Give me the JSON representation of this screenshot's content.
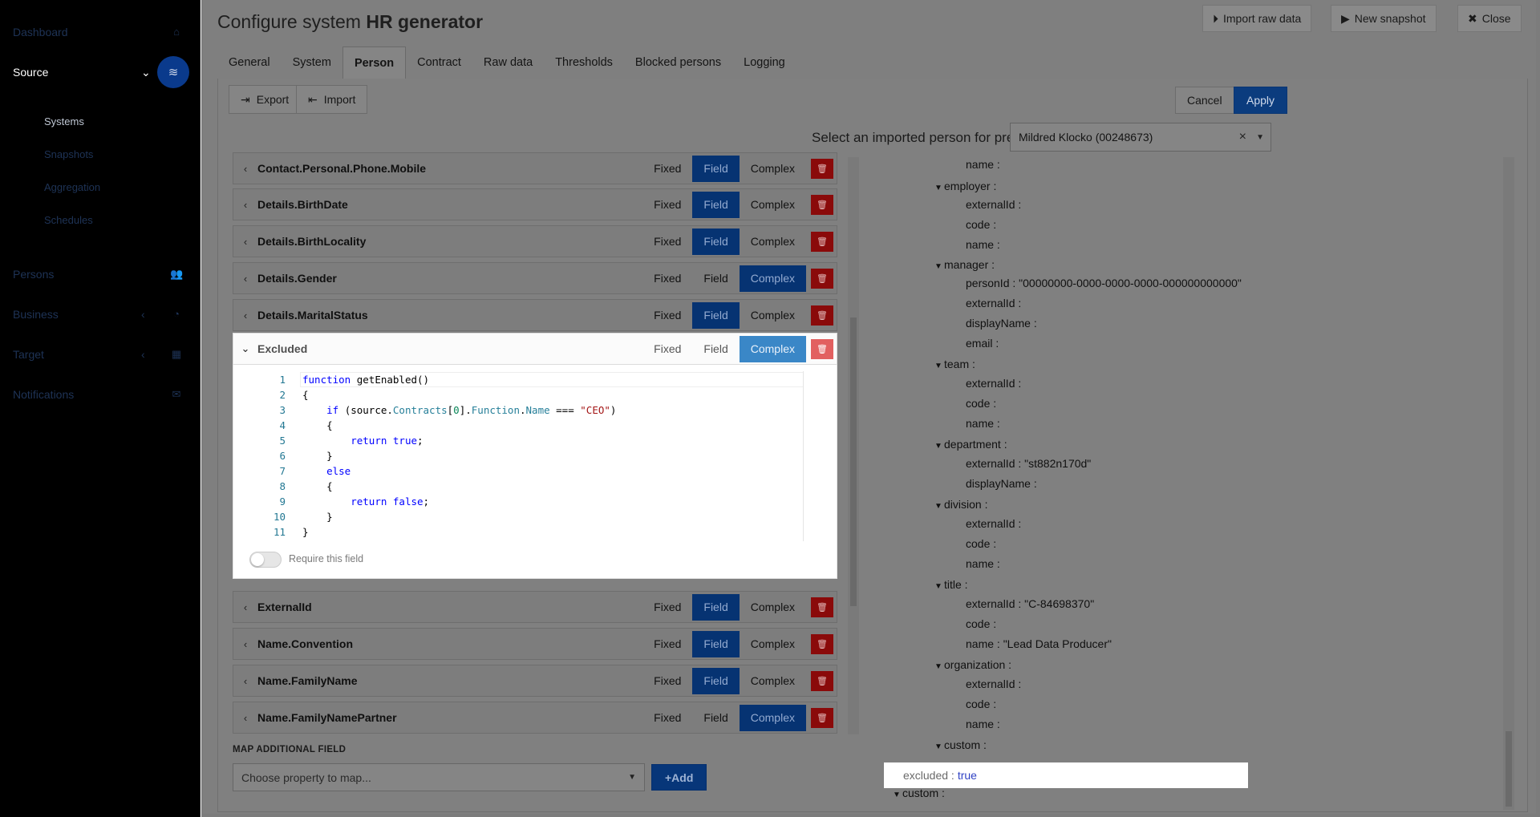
{
  "sidebar": {
    "items": [
      {
        "label": "Dashboard",
        "icon": "home-icon"
      },
      {
        "label": "Source",
        "icon": "layers-icon"
      },
      {
        "label": "Persons",
        "icon": "users-icon"
      },
      {
        "label": "Business",
        "icon": "chart-icon"
      },
      {
        "label": "Target",
        "icon": "grid-icon"
      },
      {
        "label": "Notifications",
        "icon": "envelope-icon"
      }
    ],
    "sub_items": [
      "Systems",
      "Snapshots",
      "Aggregation",
      "Schedules"
    ]
  },
  "modal": {
    "title_prefix": "Configure system",
    "title_system": "HR generator",
    "buttons": {
      "import_raw": "Import raw data",
      "new_snapshot": "New snapshot",
      "close": "Close"
    },
    "tabs": [
      "General",
      "System",
      "Person",
      "Contract",
      "Raw data",
      "Thresholds",
      "Blocked persons",
      "Logging"
    ],
    "active_tab": "Person",
    "toolbar": {
      "export": "Export",
      "import": "Import",
      "cancel": "Cancel",
      "apply": "Apply"
    },
    "preview": {
      "label": "Select an imported person for preview",
      "selected": "Mildred Klocko (00248673)"
    }
  },
  "mapping": {
    "segments": {
      "fixed": "Fixed",
      "field": "Field",
      "complex": "Complex"
    },
    "rows": [
      {
        "name": "Contact.Personal.Phone.Mobile",
        "mode": "field"
      },
      {
        "name": "Details.BirthDate",
        "mode": "field"
      },
      {
        "name": "Details.BirthLocality",
        "mode": "field"
      },
      {
        "name": "Details.Gender",
        "mode": "complex"
      },
      {
        "name": "Details.MaritalStatus",
        "mode": "field"
      },
      {
        "name": "Excluded",
        "mode": "complex",
        "expanded": true
      },
      {
        "name": "ExternalId",
        "mode": "field"
      },
      {
        "name": "Name.Convention",
        "mode": "field"
      },
      {
        "name": "Name.FamilyName",
        "mode": "field"
      },
      {
        "name": "Name.FamilyNamePartner",
        "mode": "complex"
      }
    ],
    "code_lines": [
      "1",
      "2",
      "3",
      "4",
      "5",
      "6",
      "7",
      "8",
      "9",
      "10",
      "11"
    ],
    "require_label": "Require this field",
    "additional_label": "MAP ADDITIONAL FIELD",
    "additional_placeholder": "Choose property to map...",
    "add_button": "+Add"
  },
  "tree": {
    "name_label": "name :",
    "employer": "employer :",
    "externalId": "externalId :",
    "code": "code :",
    "manager": "manager :",
    "personId": "personId : ",
    "personId_val": "\"00000000-0000-0000-0000-000000000000\"",
    "displayName": "displayName :",
    "email": "email :",
    "team": "team :",
    "department": "department :",
    "dept_ext": "externalId : ",
    "dept_ext_val": "\"st882n170d\"",
    "division": "division :",
    "title": "title :",
    "title_ext": "externalId : ",
    "title_ext_val": "\"C-84698370\"",
    "title_name": "name : ",
    "title_name_val": "\"Lead Data Producer\"",
    "organization": "organization :",
    "custom": "custom :",
    "excluded_key": "excluded :",
    "excluded_val": "true",
    "custom2": "custom :"
  }
}
